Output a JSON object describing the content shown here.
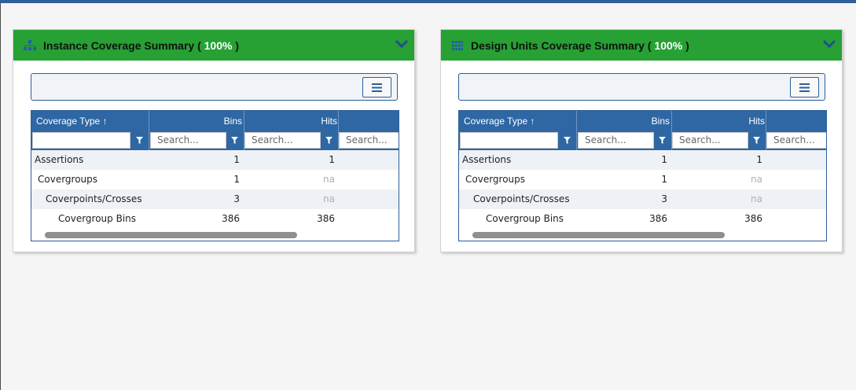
{
  "panels": [
    {
      "title": "Instance Coverage Summary (",
      "percent": "100%",
      "title_end": ")",
      "icon": "hierarchy-icon",
      "columns": [
        "Coverage Type ↑",
        "Bins",
        "Hits"
      ],
      "filter_placeholder": "Search...",
      "rows": [
        {
          "name": "Assertions",
          "bins": "1",
          "hits": "1"
        },
        {
          "name": "Covergroups",
          "bins": "1",
          "hits": "na"
        },
        {
          "name": "Coverpoints/Crosses",
          "bins": "3",
          "hits": "na"
        },
        {
          "name": "Covergroup Bins",
          "bins": "386",
          "hits": "386"
        }
      ]
    },
    {
      "title": "Design Units Coverage Summary (",
      "percent": "100%",
      "title_end": ")",
      "icon": "grid-icon",
      "columns": [
        "Coverage Type ↑",
        "Bins",
        "Hits"
      ],
      "filter_placeholder": "Search...",
      "rows": [
        {
          "name": "Assertions",
          "bins": "1",
          "hits": "1"
        },
        {
          "name": "Covergroups",
          "bins": "1",
          "hits": "na"
        },
        {
          "name": "Coverpoints/Crosses",
          "bins": "3",
          "hits": "na"
        },
        {
          "name": "Covergroup Bins",
          "bins": "386",
          "hits": "386"
        }
      ]
    }
  ],
  "colors": {
    "header_green": "#27a034",
    "grid_header_blue": "#2e67a3",
    "top_bar": "#2d5f99",
    "na_text": "#b0b0b0"
  }
}
